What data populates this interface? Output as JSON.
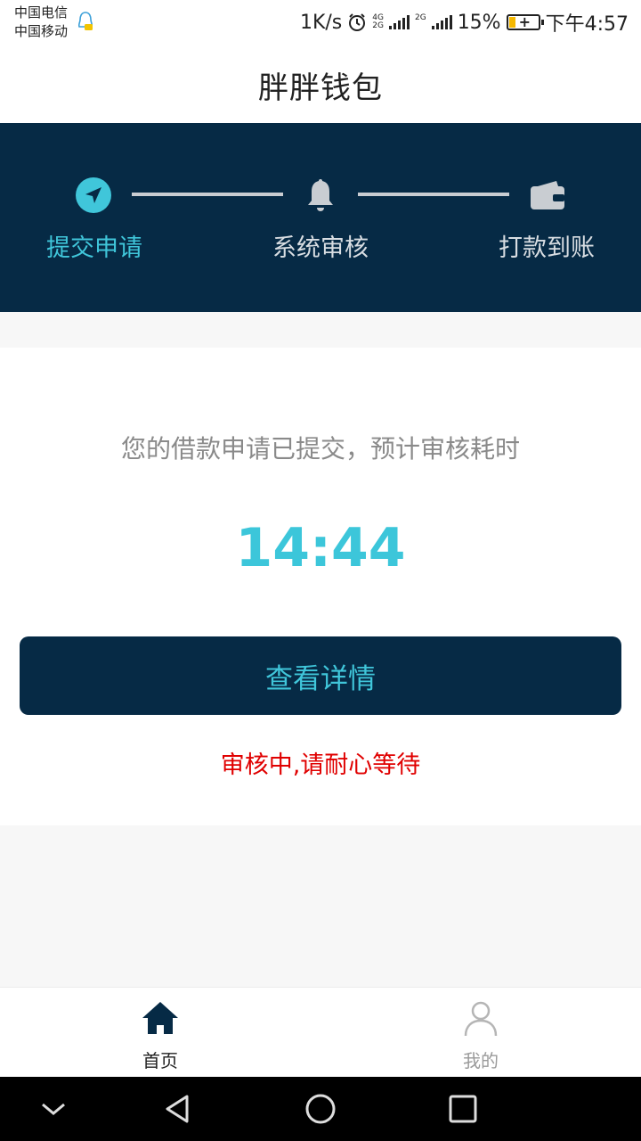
{
  "status_bar": {
    "carrier_1": "中国电信",
    "carrier_2": "中国移动",
    "speed": "1K/s",
    "net_a_top": "4G",
    "net_a_bottom": "2G",
    "net_b": "2G",
    "battery": "15%",
    "time": "下午4:57",
    "icons": [
      "qq-icon",
      "alarm-icon",
      "signal-icon",
      "battery-icon"
    ]
  },
  "header": {
    "title": "胖胖钱包"
  },
  "steps": [
    {
      "label": "提交申请",
      "icon": "send-icon",
      "active": true
    },
    {
      "label": "系统审核",
      "icon": "bell-icon",
      "active": false
    },
    {
      "label": "打款到账",
      "icon": "wallet-icon",
      "active": false
    }
  ],
  "main": {
    "message": "您的借款申请已提交，预计审核耗时",
    "timer": "14:44",
    "detail_button": "查看详情",
    "status": "审核中,请耐心等待"
  },
  "tabbar": {
    "home": "首页",
    "mine": "我的"
  },
  "colors": {
    "dark": "#062a45",
    "accent": "#40c6da",
    "warning": "#e00000"
  }
}
